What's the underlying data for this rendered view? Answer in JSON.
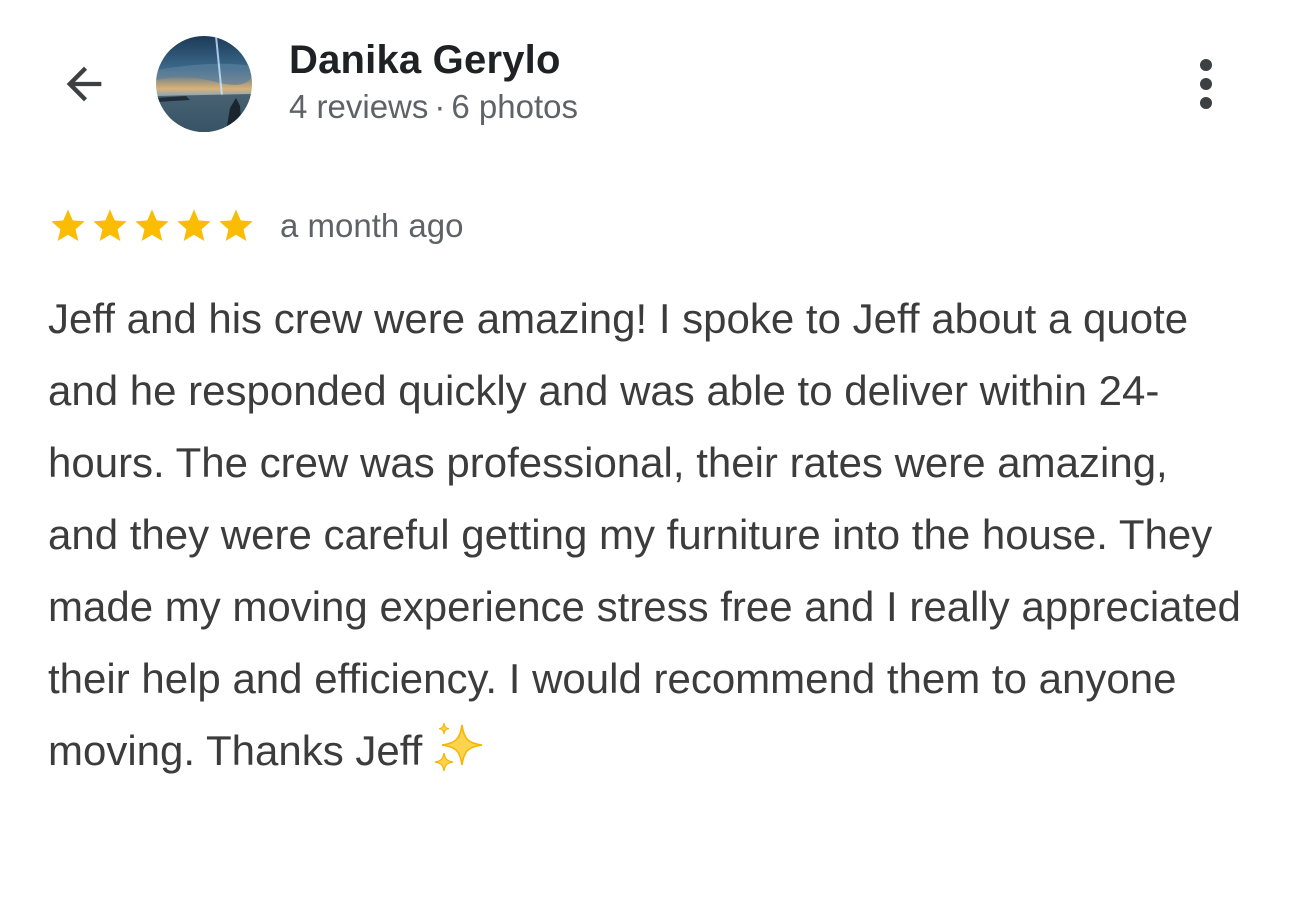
{
  "header": {
    "back_icon": "arrow-back-icon",
    "reviewer_name": "Danika Gerylo",
    "reviews_count": "4 reviews",
    "separator": "·",
    "photos_count": "6 photos",
    "more_icon": "more-vertical-icon"
  },
  "review": {
    "rating": 5,
    "rating_max": 5,
    "time_ago": "a month ago",
    "text": "Jeff and his crew were amazing! I spoke to Jeff about a quote and he responded quickly and was able to deliver within 24-hours. The crew was professional, their rates were amazing, and they were careful getting my furniture into the house. They made my moving experience stress free and I really appreciated their help and efficiency. I would recommend them to anyone moving. Thanks Jeff",
    "emoji": "sparkles-icon"
  },
  "colors": {
    "star": "#fbbc04",
    "name": "#202124",
    "secondary_text": "#5f6368",
    "body_text": "#3c3c3c"
  }
}
